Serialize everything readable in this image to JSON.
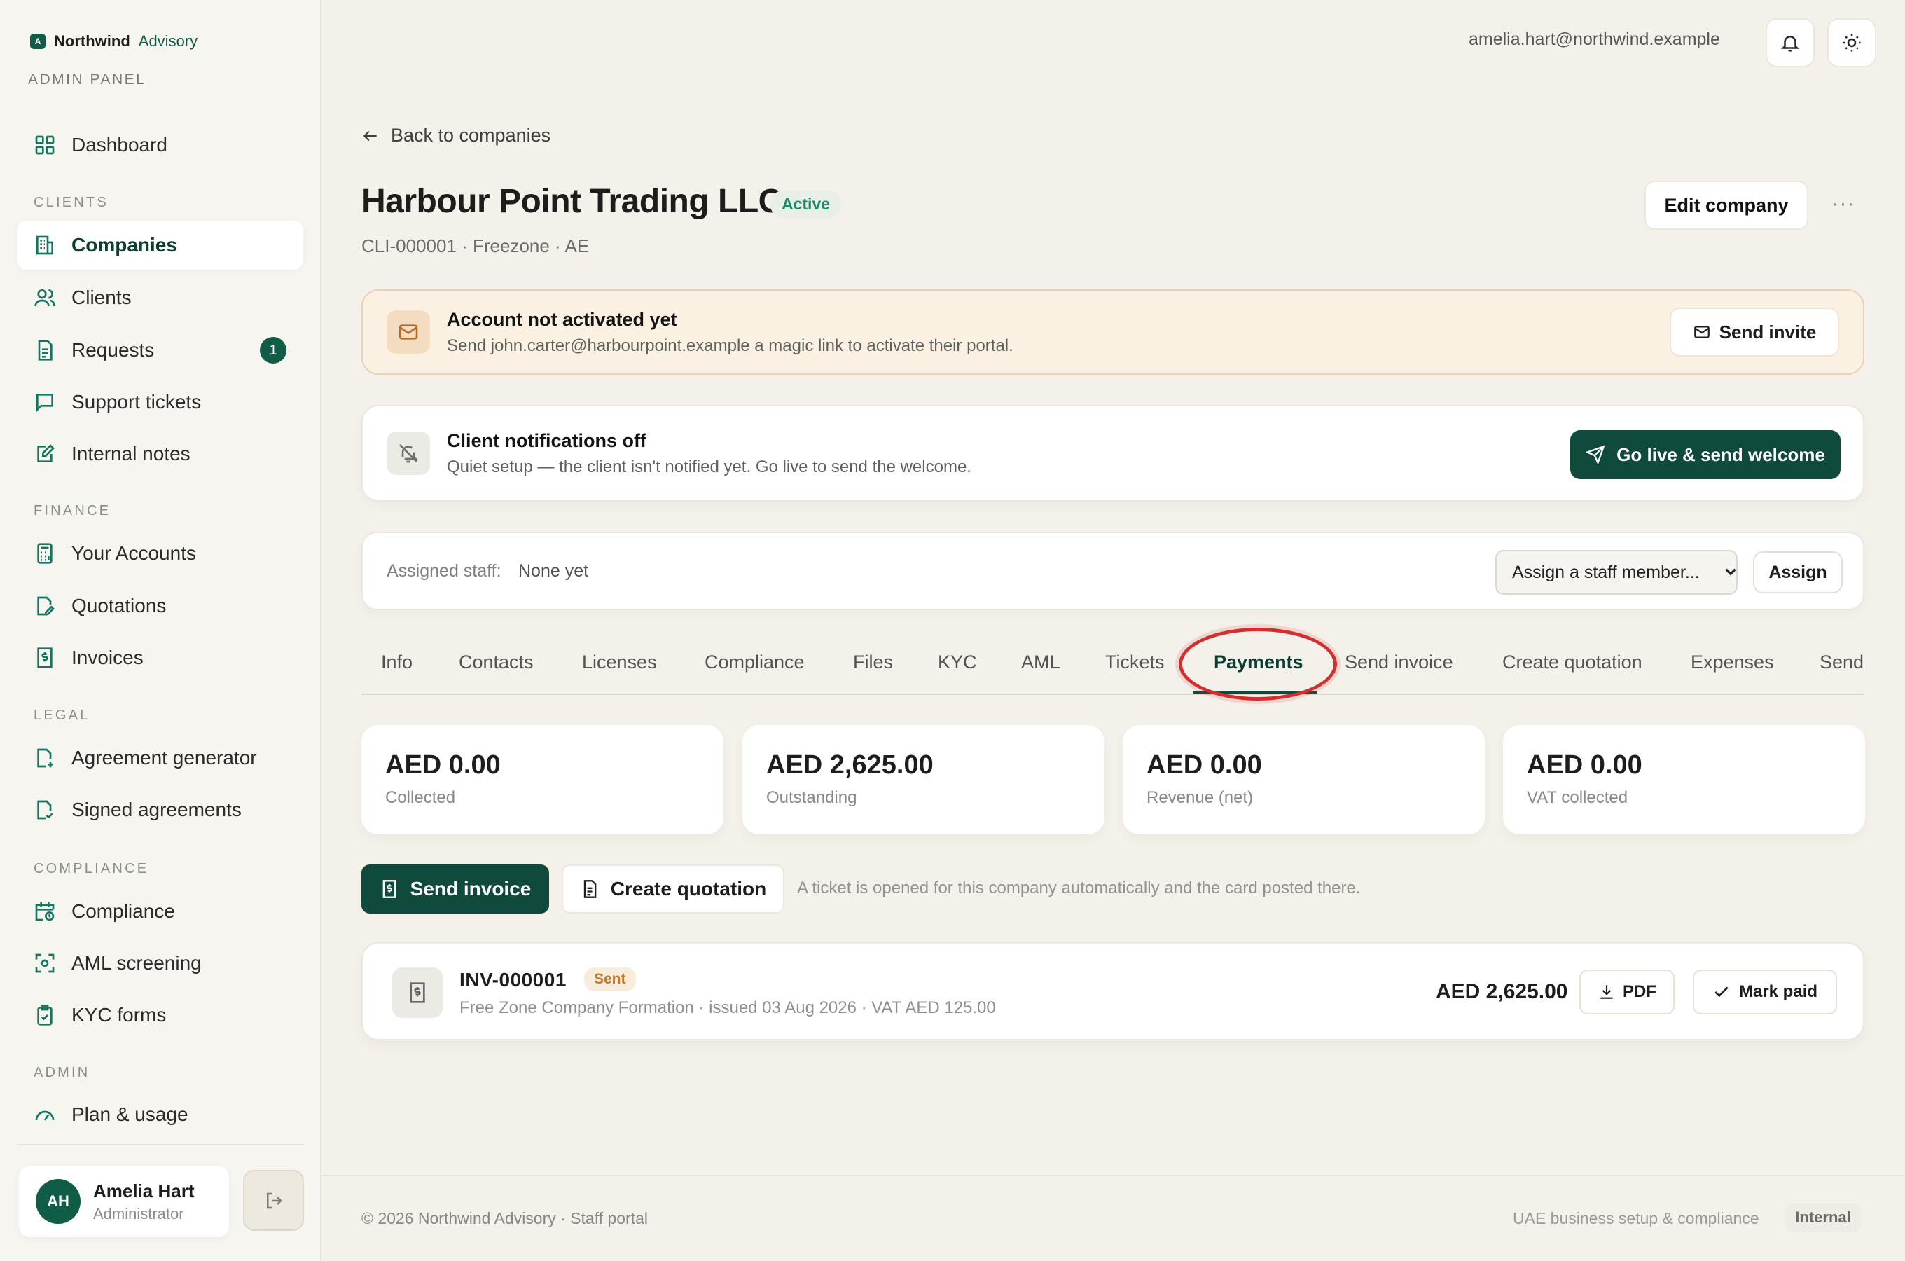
{
  "brand": {
    "name": "Northwind",
    "suffix": "Advisory",
    "logo_letter": "A",
    "panel_label": "ADMIN PANEL"
  },
  "sidebar": {
    "sections": {
      "clients": "CLIENTS",
      "finance": "FINANCE",
      "legal": "LEGAL",
      "compliance": "COMPLIANCE",
      "admin": "ADMIN"
    },
    "items": [
      {
        "label": "Dashboard",
        "icon": "grid-icon"
      },
      {
        "label": "Companies",
        "icon": "building-icon",
        "active": true
      },
      {
        "label": "Clients",
        "icon": "users-icon"
      },
      {
        "label": "Requests",
        "icon": "document-icon",
        "badge": "1"
      },
      {
        "label": "Support tickets",
        "icon": "chat-icon"
      },
      {
        "label": "Internal notes",
        "icon": "note-icon"
      },
      {
        "label": "Your Accounts",
        "icon": "calculator-icon"
      },
      {
        "label": "Quotations",
        "icon": "file-edit-icon"
      },
      {
        "label": "Invoices",
        "icon": "receipt-icon"
      },
      {
        "label": "Agreement generator",
        "icon": "file-plus-icon"
      },
      {
        "label": "Signed agreements",
        "icon": "file-check-icon"
      },
      {
        "label": "Compliance",
        "icon": "calendar-clock-icon"
      },
      {
        "label": "AML screening",
        "icon": "scan-icon"
      },
      {
        "label": "KYC forms",
        "icon": "clipboard-check-icon"
      },
      {
        "label": "Plan & usage",
        "icon": "gauge-icon"
      }
    ],
    "user": {
      "initials": "AH",
      "name": "Amelia Hart",
      "role": "Administrator"
    }
  },
  "topbar": {
    "email": "amelia.hart@northwind.example",
    "icons": [
      "bell-icon",
      "sun-icon"
    ]
  },
  "page": {
    "back_label": "Back to companies",
    "title": "Harbour Point Trading LLC",
    "status": "Active",
    "subtitle": "CLI-000001 · Freezone · AE",
    "edit_label": "Edit company",
    "more_label": "···"
  },
  "alerts": {
    "activation": {
      "title": "Account not activated yet",
      "text": "Send john.carter@harbourpoint.example a magic link to activate their portal.",
      "button": "Send invite"
    },
    "notifications": {
      "title": "Client notifications off",
      "text": "Quiet setup — the client isn't notified yet. Go live to send the welcome.",
      "button": "Go live & send welcome"
    }
  },
  "staff": {
    "label": "Assigned staff:",
    "value": "None yet",
    "select_value": "Assign a staff member...",
    "assign_label": "Assign"
  },
  "tabs": [
    "Info",
    "Contacts",
    "Licenses",
    "Compliance",
    "Files",
    "KYC",
    "AML",
    "Tickets",
    "Payments",
    "Send invoice",
    "Create quotation",
    "Expenses",
    "Send"
  ],
  "active_tab": "Payments",
  "stats": [
    {
      "value": "AED 0.00",
      "label": "Collected"
    },
    {
      "value": "AED 2,625.00",
      "label": "Outstanding"
    },
    {
      "value": "AED 0.00",
      "label": "Revenue (net)"
    },
    {
      "value": "AED 0.00",
      "label": "VAT collected"
    }
  ],
  "actions": {
    "send_invoice": "Send invoice",
    "create_quotation": "Create quotation",
    "hint": "A ticket is opened for this company automatically and the card posted there."
  },
  "invoice": {
    "number": "INV-000001",
    "status": "Sent",
    "description": "Free Zone Company Formation · issued 03 Aug 2026 · VAT AED 125.00",
    "amount": "AED 2,625.00",
    "pdf_label": "PDF",
    "mark_paid_label": "Mark paid"
  },
  "footer": {
    "copyright": "© 2026 Northwind Advisory · Staff portal",
    "tagline": "UAE business setup & compliance",
    "badge": "Internal"
  },
  "colors": {
    "accent": "#0f4a3d",
    "badge_green": "#1f8a67",
    "warning_bg": "#fbf1e3",
    "highlight": "#d32f2f"
  }
}
